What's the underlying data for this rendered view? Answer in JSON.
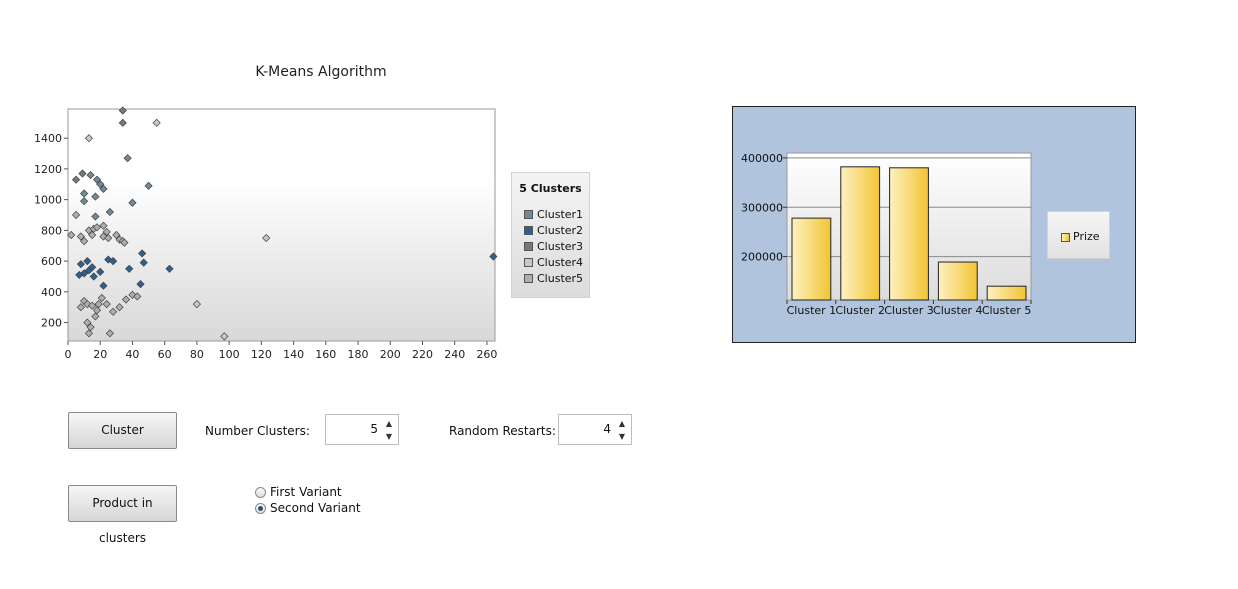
{
  "scatter": {
    "title": "K-Means Algorithm",
    "chart_data": {
      "type": "scatter",
      "xlim": [
        0,
        265
      ],
      "ylim": [
        80,
        1590
      ],
      "xticks": [
        0,
        20,
        40,
        60,
        80,
        100,
        120,
        140,
        160,
        180,
        200,
        220,
        240,
        260
      ],
      "yticks": [
        200,
        400,
        600,
        800,
        1000,
        1200,
        1400
      ],
      "legend_title": "5 Clusters",
      "series": [
        {
          "name": "Cluster1",
          "color": "#708a9a",
          "points": [
            [
              37,
              1270
            ],
            [
              14,
              1160
            ],
            [
              18,
              1130
            ],
            [
              20,
              1100
            ],
            [
              22,
              1070
            ],
            [
              10,
              1040
            ],
            [
              17,
              1020
            ],
            [
              50,
              1090
            ],
            [
              40,
              980
            ],
            [
              10,
              990
            ],
            [
              26,
              920
            ],
            [
              17,
              890
            ]
          ]
        },
        {
          "name": "Cluster2",
          "color": "#2e5f91",
          "points": [
            [
              12,
              600
            ],
            [
              8,
              580
            ],
            [
              15,
              560
            ],
            [
              25,
              610
            ],
            [
              28,
              600
            ],
            [
              46,
              650
            ],
            [
              13,
              540
            ],
            [
              47,
              590
            ],
            [
              38,
              550
            ],
            [
              63,
              550
            ],
            [
              20,
              530
            ],
            [
              10,
              520
            ],
            [
              7,
              510
            ],
            [
              16,
              500
            ],
            [
              45,
              450
            ],
            [
              22,
              440
            ],
            [
              264,
              630
            ]
          ]
        },
        {
          "name": "Cluster3",
          "color": "#787878",
          "points": [
            [
              5,
              1130
            ],
            [
              9,
              1170
            ],
            [
              34,
              1580
            ],
            [
              34,
              1500
            ]
          ]
        },
        {
          "name": "Cluster4",
          "color": "#c8c8c8",
          "points": [
            [
              13,
              1400
            ],
            [
              55,
              1500
            ],
            [
              123,
              750
            ],
            [
              80,
              320
            ],
            [
              97,
              110
            ]
          ]
        },
        {
          "name": "Cluster5",
          "color": "#aeaeae",
          "points": [
            [
              5,
              900
            ],
            [
              2,
              770
            ],
            [
              8,
              760
            ],
            [
              10,
              730
            ],
            [
              13,
              800
            ],
            [
              16,
              810
            ],
            [
              18,
              820
            ],
            [
              22,
              830
            ],
            [
              24,
              790
            ],
            [
              30,
              770
            ],
            [
              32,
              740
            ],
            [
              34,
              730
            ],
            [
              35,
              720
            ],
            [
              22,
              760
            ],
            [
              15,
              770
            ],
            [
              25,
              750
            ],
            [
              10,
              340
            ],
            [
              12,
              320
            ],
            [
              15,
              310
            ],
            [
              18,
              280
            ],
            [
              21,
              360
            ],
            [
              24,
              320
            ],
            [
              28,
              270
            ],
            [
              32,
              300
            ],
            [
              36,
              350
            ],
            [
              40,
              380
            ],
            [
              43,
              370
            ],
            [
              8,
              300
            ],
            [
              12,
              200
            ],
            [
              14,
              170
            ],
            [
              13,
              130
            ],
            [
              17,
              240
            ],
            [
              26,
              130
            ],
            [
              19,
              320
            ]
          ]
        }
      ]
    }
  },
  "controls": {
    "cluster_button": "Cluster",
    "num_clusters_label": "Number Clusters:",
    "num_clusters_value": "5",
    "random_restarts_label": "Random Restarts:",
    "random_restarts_value": "4",
    "product_button": "Product in clusters",
    "radio_first": "First Variant",
    "radio_second": "Second Variant",
    "selected_variant": "second"
  },
  "bar": {
    "chart_data": {
      "type": "bar",
      "categories": [
        "Cluster 1",
        "Cluster 2",
        "Cluster 3",
        "Cluster 4",
        "Cluster 5"
      ],
      "series": [
        {
          "name": "Prize",
          "values": [
            278000,
            382000,
            380000,
            189000,
            140000
          ]
        }
      ],
      "ylim": [
        112000,
        410000
      ],
      "yticks": [
        200000,
        300000,
        400000
      ],
      "colors": {
        "bar_light": "#fdf1c2",
        "bar_dark": "#f2c433",
        "panel": "#b0c4de"
      }
    }
  }
}
